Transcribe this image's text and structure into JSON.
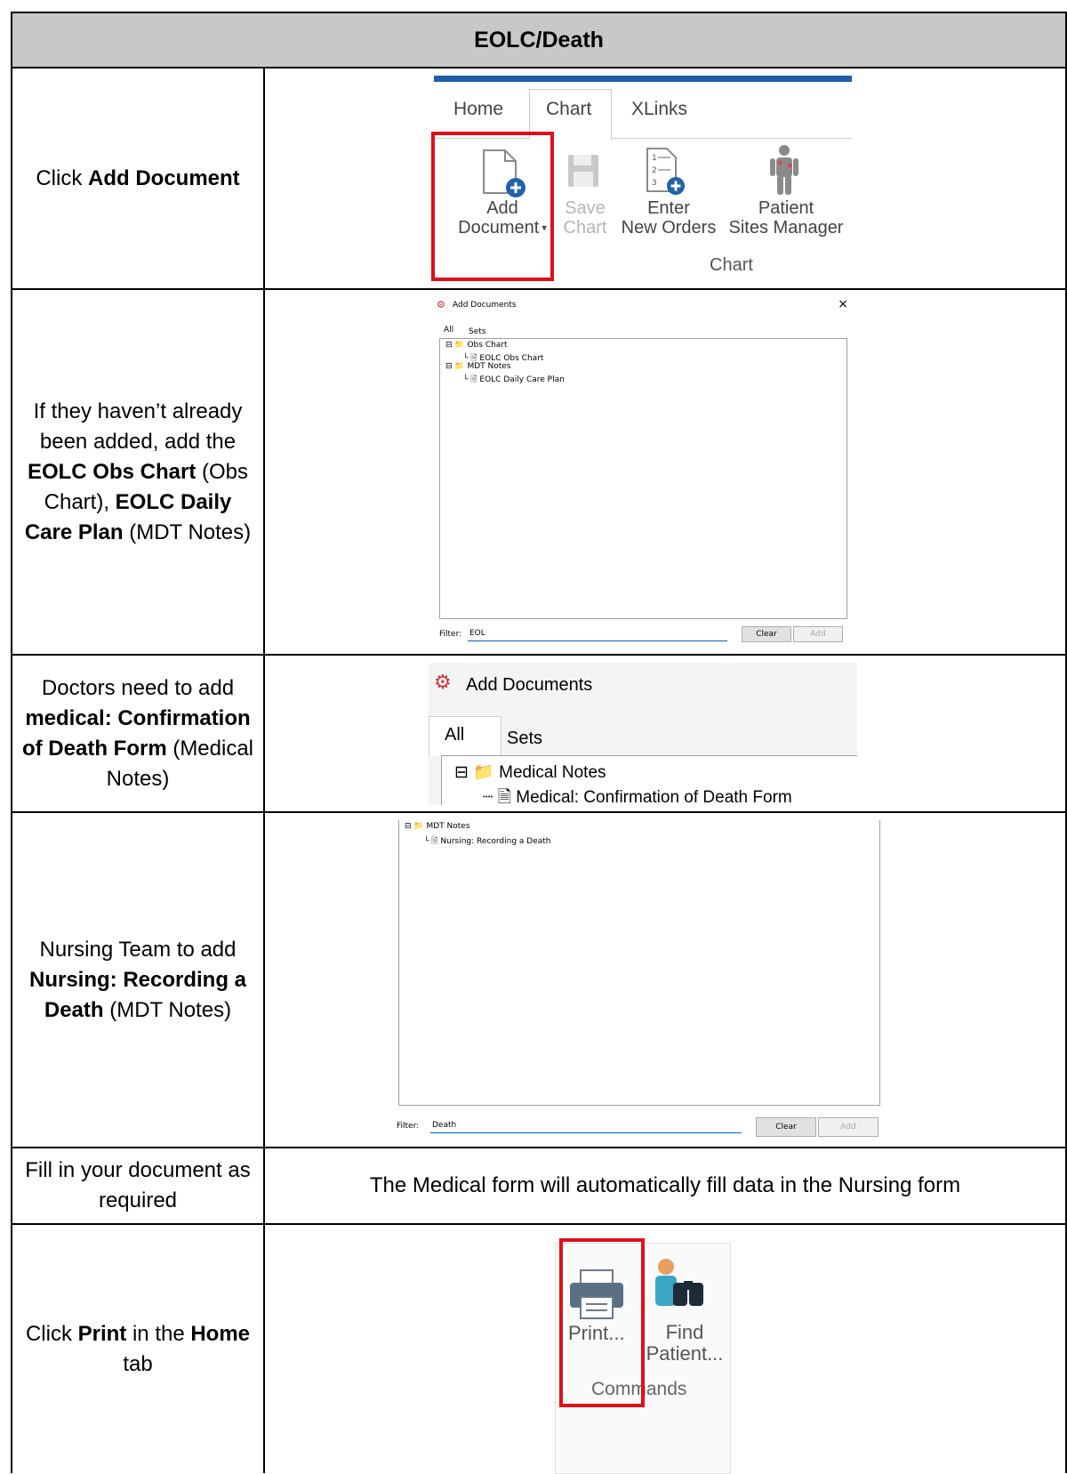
{
  "title": "EOLC/Death",
  "rows": [
    {
      "instruction_pre": "Click ",
      "instruction_bold": "Add Document"
    },
    {
      "instruction_pre": "If they haven’t already been added, add the ",
      "b1": "EOLC Obs Chart",
      "t1": " (Obs Chart), ",
      "b2": "EOLC Daily Care Plan",
      "t2": " (MDT Notes)"
    },
    {
      "pre": "Doctors need to add ",
      "bold": "medical: Confirmation of Death Form",
      "post": " (Medical Notes)"
    },
    {
      "pre": "Nursing Team to add ",
      "bold": "Nursing: Recording a Death",
      "post": " (MDT Notes)"
    },
    {
      "text": "Fill in your document as required",
      "note": "The Medical form will automatically fill data in the Nursing form"
    },
    {
      "pre": "Click ",
      "bold1": "Print",
      "mid": " in the ",
      "bold2": "Home",
      "post": " tab"
    }
  ],
  "ribbon": {
    "tabs": [
      "Home",
      "Chart",
      "XLinks"
    ],
    "buttons": [
      {
        "line1": "Add",
        "line2": "Document"
      },
      {
        "line1": "Save",
        "line2": "Chart"
      },
      {
        "line1": "Enter",
        "line2": "New Orders"
      },
      {
        "line1": "Patient",
        "line2": "Sites Manager"
      }
    ],
    "group": "Chart",
    "accent": "#1e5fa5",
    "highlight": "#e0101a"
  },
  "dialog1": {
    "title": "Add Documents",
    "close": "×",
    "tabs": [
      "All",
      "Sets"
    ],
    "tree": [
      "Obs Chart",
      "EOLC Obs Chart",
      "MDT Notes",
      "EOLC Daily Care Plan"
    ],
    "filter_label": "Filter:",
    "filter_value": "EOL",
    "clear": "Clear",
    "add": "Add"
  },
  "dialog2": {
    "title": "Add Documents",
    "tabs": [
      "All",
      "Sets"
    ],
    "tree": [
      "Medical Notes",
      "Medical: Confirmation of Death Form"
    ]
  },
  "dialog3": {
    "tree": [
      "MDT Notes",
      "Nursing: Recording a Death"
    ],
    "filter_label": "Filter:",
    "filter_value": "Death",
    "clear": "Clear",
    "add": "Add"
  },
  "commands": {
    "print_label": "Print...",
    "find_line1": "Find",
    "find_line2": "Patient...",
    "group": "Commands"
  }
}
